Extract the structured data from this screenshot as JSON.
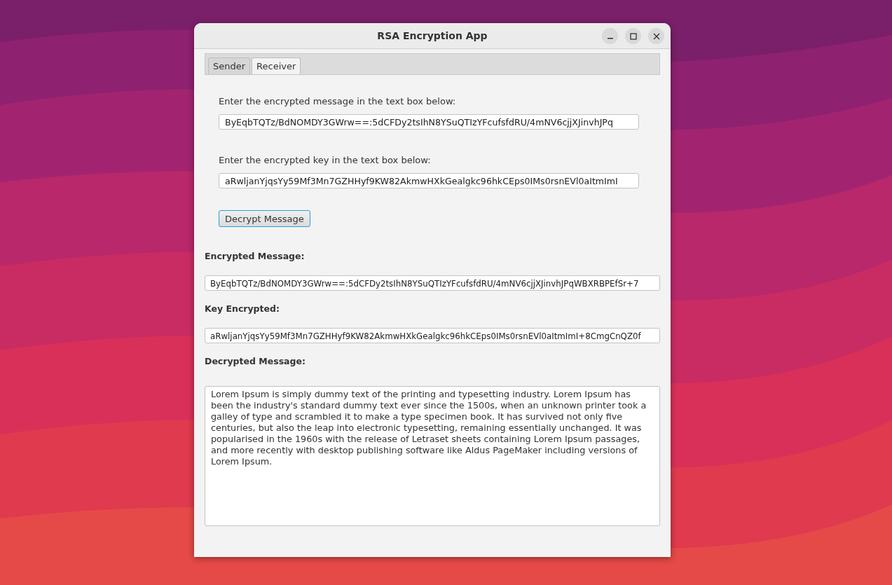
{
  "window": {
    "title": "RSA Encryption App"
  },
  "tabs": [
    {
      "label": "Sender",
      "selected": false
    },
    {
      "label": "Receiver",
      "selected": true
    }
  ],
  "message_input": {
    "label": "Enter the encrypted message in the text box below:",
    "value": "ByEqbTQTz/BdNOMDY3GWrw==:5dCFDy2tsIhN8YSuQTIzYFcufsfdRU/4mNV6cjjXJinvhJPq"
  },
  "key_input": {
    "label": "Enter the encrypted key in the text box below:",
    "value": "aRwljanYjqsYy59Mf3Mn7GZHHyf9KW82AkmwHXkGealgkc96hkCEps0IMs0rsnEVl0aItmImI"
  },
  "decrypt_button": "Decrypt Message",
  "encrypted_message": {
    "label": "Encrypted Message:",
    "value": "ByEqbTQTz/BdNOMDY3GWrw==:5dCFDy2tsIhN8YSuQTIzYFcufsfdRU/4mNV6cjjXJinvhJPqWBXRBPEfSr+7"
  },
  "key_encrypted": {
    "label": "Key Encrypted:",
    "value": "aRwljanYjqsYy59Mf3Mn7GZHHyf9KW82AkmwHXkGealgkc96hkCEps0IMs0rsnEVl0aItmImI+8CmgCnQZ0f"
  },
  "decrypted_message": {
    "label": "Decrypted Message:",
    "value": "Lorem Ipsum is simply dummy text of the printing and typesetting industry. Lorem Ipsum has been the industry's standard dummy text ever since the 1500s, when an unknown printer took a galley of type and scrambled it to make a type specimen book. It has survived not only five centuries, but also the leap into electronic typesetting, remaining essentially unchanged. It was popularised in the 1960s with the release of Letraset sheets containing Lorem Ipsum passages, and more recently with desktop publishing software like Aldus PageMaker including versions of Lorem Ipsum."
  }
}
